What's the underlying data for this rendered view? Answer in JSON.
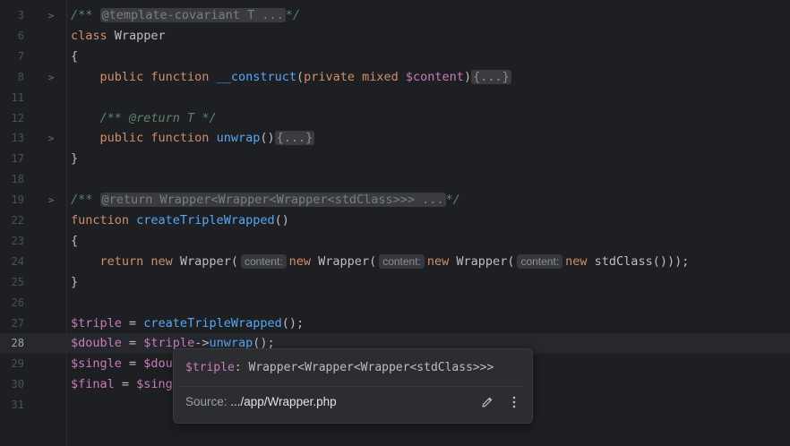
{
  "editor": {
    "lines": [
      {
        "num": "3",
        "fold": ">",
        "parts": [
          {
            "cls": "doc",
            "t": "/** "
          },
          {
            "cls": "fold-box doc-fold",
            "t": "@template-covariant T ..."
          },
          {
            "cls": "doc",
            "t": "*/"
          }
        ]
      },
      {
        "num": "6",
        "fold": "",
        "parts": [
          {
            "cls": "kw",
            "t": "class "
          },
          {
            "cls": "cls",
            "t": "Wrapper"
          }
        ]
      },
      {
        "num": "7",
        "fold": "",
        "parts": [
          {
            "cls": "punc",
            "t": "{"
          }
        ]
      },
      {
        "num": "8",
        "fold": ">",
        "parts": [
          {
            "cls": "punc",
            "t": "    "
          },
          {
            "cls": "kw",
            "t": "public function "
          },
          {
            "cls": "fn",
            "t": "__construct"
          },
          {
            "cls": "punc",
            "t": "("
          },
          {
            "cls": "kw",
            "t": "private mixed "
          },
          {
            "cls": "var",
            "t": "$content"
          },
          {
            "cls": "punc",
            "t": ")"
          },
          {
            "cls": "fold-box",
            "t": "{...}"
          }
        ]
      },
      {
        "num": "11",
        "fold": "",
        "parts": []
      },
      {
        "num": "12",
        "fold": "",
        "parts": [
          {
            "cls": "punc",
            "t": "    "
          },
          {
            "cls": "doc",
            "t": "/** "
          },
          {
            "cls": "doctag",
            "t": "@return T"
          },
          {
            "cls": "doc",
            "t": " */"
          }
        ]
      },
      {
        "num": "13",
        "fold": ">",
        "parts": [
          {
            "cls": "punc",
            "t": "    "
          },
          {
            "cls": "kw",
            "t": "public function "
          },
          {
            "cls": "fn",
            "t": "unwrap"
          },
          {
            "cls": "punc",
            "t": "()"
          },
          {
            "cls": "fold-box",
            "t": "{...}"
          }
        ]
      },
      {
        "num": "17",
        "fold": "",
        "parts": [
          {
            "cls": "punc",
            "t": "}"
          }
        ]
      },
      {
        "num": "18",
        "fold": "",
        "parts": []
      },
      {
        "num": "19",
        "fold": ">",
        "parts": [
          {
            "cls": "doc",
            "t": "/** "
          },
          {
            "cls": "fold-box doc-fold",
            "t": "@return Wrapper<Wrapper<Wrapper<stdClass>>> ..."
          },
          {
            "cls": "doc",
            "t": "*/"
          }
        ]
      },
      {
        "num": "22",
        "fold": "",
        "parts": [
          {
            "cls": "kw",
            "t": "function "
          },
          {
            "cls": "fn",
            "t": "createTripleWrapped"
          },
          {
            "cls": "punc",
            "t": "()"
          }
        ]
      },
      {
        "num": "23",
        "fold": "",
        "parts": [
          {
            "cls": "punc",
            "t": "{"
          }
        ]
      },
      {
        "num": "24",
        "fold": "",
        "parts": [
          {
            "cls": "punc",
            "t": "    "
          },
          {
            "cls": "kw",
            "t": "return new "
          },
          {
            "cls": "cls",
            "t": "Wrapper("
          },
          {
            "cls": "hint",
            "t": "content:"
          },
          {
            "cls": "kw",
            "t": "new "
          },
          {
            "cls": "cls",
            "t": "Wrapper("
          },
          {
            "cls": "hint",
            "t": "content:"
          },
          {
            "cls": "kw",
            "t": "new "
          },
          {
            "cls": "cls",
            "t": "Wrapper("
          },
          {
            "cls": "hint",
            "t": "content:"
          },
          {
            "cls": "kw",
            "t": "new "
          },
          {
            "cls": "cls",
            "t": "stdClass()));"
          }
        ]
      },
      {
        "num": "25",
        "fold": "",
        "parts": [
          {
            "cls": "punc",
            "t": "}"
          }
        ]
      },
      {
        "num": "26",
        "fold": "",
        "parts": []
      },
      {
        "num": "27",
        "fold": "",
        "parts": [
          {
            "cls": "var",
            "t": "$triple"
          },
          {
            "cls": "punc",
            "t": " = "
          },
          {
            "cls": "fn-call",
            "t": "createTripleWrapped"
          },
          {
            "cls": "punc",
            "t": "();"
          }
        ]
      },
      {
        "num": "28",
        "fold": "",
        "current": true,
        "parts": [
          {
            "cls": "var",
            "t": "$double"
          },
          {
            "cls": "punc",
            "t": " = "
          },
          {
            "cls": "var",
            "t": "$triple"
          },
          {
            "cls": "punc",
            "t": "->"
          },
          {
            "cls": "fn-call",
            "t": "unwrap"
          },
          {
            "cls": "punc",
            "t": "();"
          }
        ]
      },
      {
        "num": "29",
        "fold": "",
        "parts": [
          {
            "cls": "var",
            "t": "$single"
          },
          {
            "cls": "punc",
            "t": " = "
          },
          {
            "cls": "var",
            "t": "$dou"
          }
        ]
      },
      {
        "num": "30",
        "fold": "",
        "parts": [
          {
            "cls": "var",
            "t": "$final"
          },
          {
            "cls": "punc",
            "t": " = "
          },
          {
            "cls": "var",
            "t": "$sing"
          }
        ]
      },
      {
        "num": "31",
        "fold": "",
        "parts": []
      }
    ]
  },
  "popup": {
    "var_name": "$triple",
    "type_text": ": Wrapper<Wrapper<Wrapper<stdClass>>>",
    "source_label": "Source: ",
    "source_path": ".../app/Wrapper.php",
    "edit_icon": "pencil-icon",
    "more_icon": "more-vertical-icon"
  },
  "colors": {
    "background": "#1e1f22",
    "keyword": "#cf8e6d",
    "function": "#56a8f5",
    "variable": "#c77dbb",
    "comment": "#5f826b"
  }
}
